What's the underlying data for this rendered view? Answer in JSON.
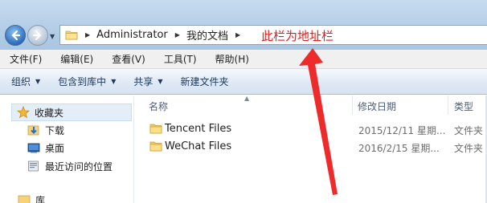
{
  "address": {
    "crumbs": [
      "Administrator",
      "我的文档"
    ],
    "annotation_text": "此栏为地址栏"
  },
  "menu": [
    "文件(F)",
    "编辑(E)",
    "查看(V)",
    "工具(T)",
    "帮助(H)"
  ],
  "commands": [
    {
      "label": "组织",
      "dropdown": true
    },
    {
      "label": "包含到库中",
      "dropdown": true
    },
    {
      "label": "共享",
      "dropdown": true
    },
    {
      "label": "新建文件夹",
      "dropdown": false
    }
  ],
  "nav": {
    "favorites": "收藏夹",
    "items": [
      "下载",
      "桌面",
      "最近访问的位置"
    ],
    "library": "库"
  },
  "columns": {
    "name": "名称",
    "date": "修改日期",
    "type": "类型"
  },
  "files": [
    {
      "name": "Tencent Files",
      "date": "2015/12/11 星期...",
      "type": "文件夹"
    },
    {
      "name": "WeChat Files",
      "date": "2016/2/15 星期...",
      "type": "文件夹"
    }
  ],
  "colors": {
    "annotation": "#e11c1c",
    "accent": "#2e6db8"
  }
}
